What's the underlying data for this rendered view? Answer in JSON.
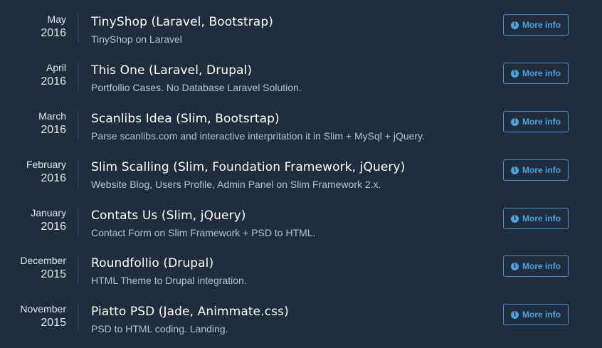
{
  "entries": [
    {
      "month": "May",
      "year": "2016",
      "title": "TinyShop (Laravel, Bootstrap)",
      "description": "TinyShop on Laravel",
      "button_label": "More info",
      "button_icon": "info-circle-icon"
    },
    {
      "month": "April",
      "year": "2016",
      "title": "This One (Laravel, Drupal)",
      "description": "Portfollio Cases. No Database Laravel Solution.",
      "button_label": "More info",
      "button_icon": "info-circle-icon"
    },
    {
      "month": "March",
      "year": "2016",
      "title": "Scanlibs Idea (Slim, Bootsrtap)",
      "description": "Parse scanlibs.com and interactive interpritation it in Slim + MySql + jQuery.",
      "button_label": "More info",
      "button_icon": "info-circle-icon"
    },
    {
      "month": "February",
      "year": "2016",
      "title": "Slim Scalling (Slim, Foundation Framework, jQuery)",
      "description": "Website Blog, Users Profile, Admin Panel on Slim Framework 2.x.",
      "button_label": "More info",
      "button_icon": "info-circle-icon"
    },
    {
      "month": "January",
      "year": "2016",
      "title": "Contats Us (Slim, jQuery)",
      "description": "Contact Form on Slim Framework + PSD to HTML.",
      "button_label": "More info",
      "button_icon": "info-circle-icon"
    },
    {
      "month": "December",
      "year": "2015",
      "title": "Roundfollio (Drupal)",
      "description": "HTML Theme to Drupal integration.",
      "button_label": "More info",
      "button_icon": "info-circle-icon"
    },
    {
      "month": "November",
      "year": "2015",
      "title": "Piatto PSD (Jade, Animmate.css)",
      "description": "PSD to HTML coding. Landing.",
      "button_label": "More info",
      "button_icon": "info-circle-icon"
    }
  ],
  "colors": {
    "background": "#1f2d3c",
    "accent": "#4aa3e4",
    "title": "#ffffff",
    "description": "#b5c2cf"
  }
}
